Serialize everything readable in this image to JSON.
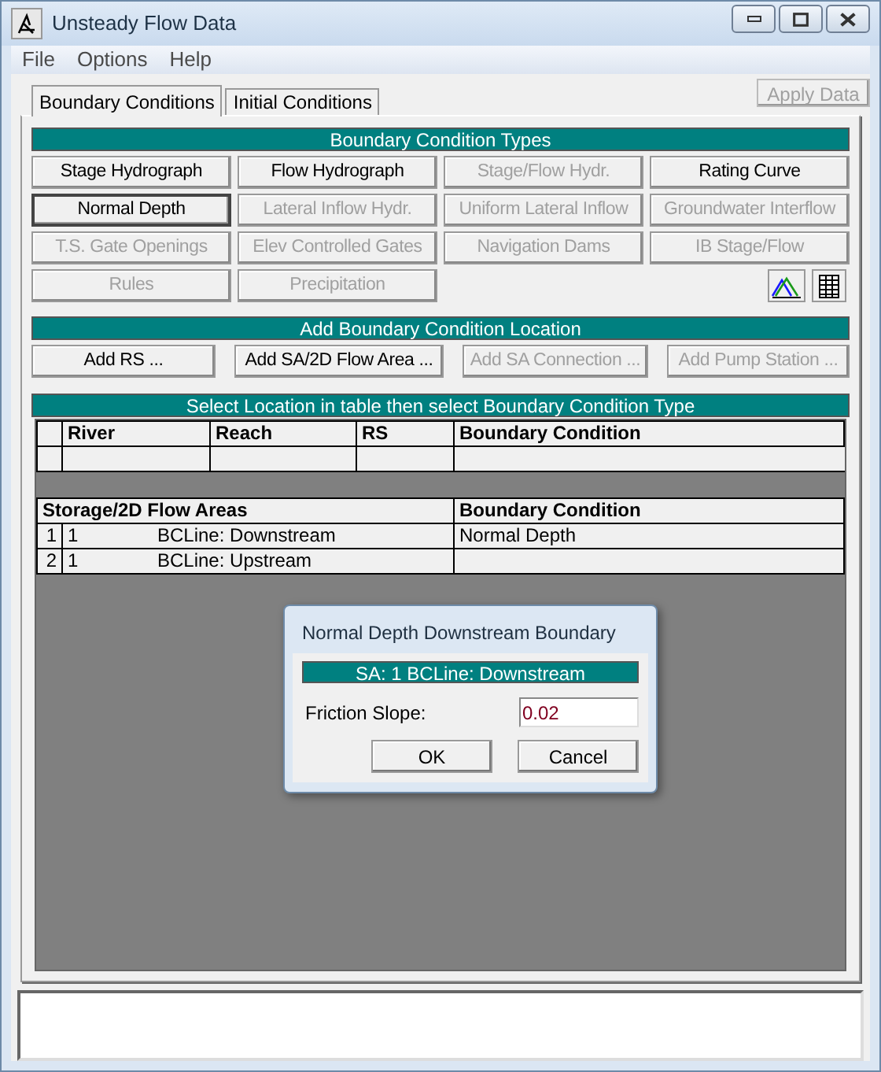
{
  "window": {
    "title": "Unsteady Flow Data"
  },
  "menu": [
    "File",
    "Options",
    "Help"
  ],
  "tabs": [
    {
      "label": "Boundary Conditions",
      "selected": true
    },
    {
      "label": "Initial Conditions",
      "selected": false
    }
  ],
  "apply_button": {
    "label": "Apply Data",
    "disabled": true
  },
  "type_section": {
    "title": "Boundary Condition Types",
    "buttons": [
      {
        "label": "Stage Hydrograph",
        "disabled": false,
        "selected": false
      },
      {
        "label": "Flow Hydrograph",
        "disabled": false,
        "selected": false
      },
      {
        "label": "Stage/Flow Hydr.",
        "disabled": true,
        "selected": false
      },
      {
        "label": "Rating Curve",
        "disabled": false,
        "selected": false
      },
      {
        "label": "Normal Depth",
        "disabled": false,
        "selected": true
      },
      {
        "label": "Lateral Inflow Hydr.",
        "disabled": true,
        "selected": false
      },
      {
        "label": "Uniform Lateral Inflow",
        "disabled": true,
        "selected": false
      },
      {
        "label": "Groundwater Interflow",
        "disabled": true,
        "selected": false
      },
      {
        "label": "T.S. Gate Openings",
        "disabled": true,
        "selected": false
      },
      {
        "label": "Elev Controlled Gates",
        "disabled": true,
        "selected": false
      },
      {
        "label": "Navigation Dams",
        "disabled": true,
        "selected": false
      },
      {
        "label": "IB Stage/Flow",
        "disabled": true,
        "selected": false
      },
      {
        "label": "Rules",
        "disabled": true,
        "selected": false
      },
      {
        "label": "Precipitation",
        "disabled": true,
        "selected": false
      }
    ]
  },
  "location_section": {
    "title": "Add Boundary Condition Location",
    "buttons": [
      {
        "label": "Add RS ...",
        "disabled": false
      },
      {
        "label": "Add SA/2D Flow Area ...",
        "disabled": false
      },
      {
        "label": "Add SA Connection ...",
        "disabled": true
      },
      {
        "label": "Add Pump Station ...",
        "disabled": true
      }
    ]
  },
  "table_section": {
    "title": "Select Location in table then select Boundary Condition Type",
    "river_table": {
      "columns": [
        "River",
        "Reach",
        "RS",
        "Boundary Condition"
      ]
    },
    "storage_table": {
      "columns": [
        "Storage/2D Flow Areas",
        "Boundary Condition"
      ],
      "rows": [
        {
          "index": "1",
          "area": "1",
          "bc_line": "BCLine: Downstream",
          "boundary_condition": "Normal Depth"
        },
        {
          "index": "2",
          "area": "1",
          "bc_line": "BCLine: Upstream"
        }
      ]
    }
  },
  "dialog": {
    "title": "Normal Depth Downstream Boundary",
    "location": "SA: 1 BCLine: Downstream",
    "field_label": "Friction Slope:",
    "value": "0.02",
    "buttons": [
      "OK",
      "Cancel"
    ]
  }
}
